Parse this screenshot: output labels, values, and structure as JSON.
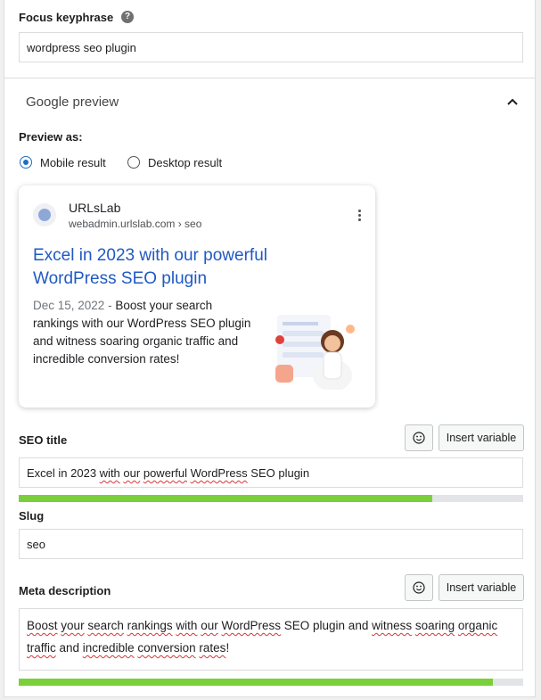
{
  "focus_keyphrase": {
    "label": "Focus keyphrase",
    "value": "wordpress seo plugin"
  },
  "google_preview": {
    "title": "Google preview",
    "preview_as_label": "Preview as:",
    "options": [
      "Mobile result",
      "Desktop result"
    ],
    "selected": "Mobile result",
    "card": {
      "site_name": "URLsLab",
      "site_url": "webadmin.urlslab.com › seo",
      "title": "Excel in 2023 with our powerful WordPress SEO plugin",
      "date": "Dec 15, 2022",
      "separator": " - ",
      "description": "Boost your search rankings with our WordPress SEO plugin and witness soaring organic traffic and incredible conversion rates!"
    }
  },
  "seo_title": {
    "label": "SEO title",
    "insert_variable": "Insert variable",
    "segments": [
      {
        "t": "Excel in 2023 ",
        "sq": false
      },
      {
        "t": "with",
        "sq": true
      },
      {
        "t": " ",
        "sq": false
      },
      {
        "t": "our",
        "sq": true
      },
      {
        "t": " ",
        "sq": false
      },
      {
        "t": "powerful",
        "sq": true
      },
      {
        "t": " ",
        "sq": false
      },
      {
        "t": "WordPress",
        "sq": true
      },
      {
        "t": " SEO plugin",
        "sq": false
      }
    ],
    "progress": 0.82,
    "progress_color": "#7ad03a"
  },
  "slug": {
    "label": "Slug",
    "value": "seo"
  },
  "meta_description": {
    "label": "Meta description",
    "insert_variable": "Insert variable",
    "segments": [
      {
        "t": "Boost",
        "sq": true
      },
      {
        "t": " ",
        "sq": false
      },
      {
        "t": "your",
        "sq": true
      },
      {
        "t": " ",
        "sq": false
      },
      {
        "t": "search",
        "sq": true
      },
      {
        "t": " ",
        "sq": false
      },
      {
        "t": "rankings",
        "sq": true
      },
      {
        "t": " ",
        "sq": false
      },
      {
        "t": "with",
        "sq": true
      },
      {
        "t": " ",
        "sq": false
      },
      {
        "t": "our",
        "sq": true
      },
      {
        "t": " ",
        "sq": false
      },
      {
        "t": "WordPress",
        "sq": true
      },
      {
        "t": " SEO plugin and ",
        "sq": false
      },
      {
        "t": "witness",
        "sq": true
      },
      {
        "t": " ",
        "sq": false
      },
      {
        "t": "soaring",
        "sq": true
      },
      {
        "t": " ",
        "sq": false
      },
      {
        "t": "organic",
        "sq": true
      },
      {
        "t": " ",
        "sq": false
      },
      {
        "t": "traffic",
        "sq": true
      },
      {
        "t": " and ",
        "sq": false
      },
      {
        "t": "incredible",
        "sq": true
      },
      {
        "t": " ",
        "sq": false
      },
      {
        "t": "conversion",
        "sq": true
      },
      {
        "t": " ",
        "sq": false
      },
      {
        "t": "rates",
        "sq": true
      },
      {
        "t": "!",
        "sq": false
      }
    ],
    "progress": 0.94,
    "progress_color": "#7ad03a"
  },
  "icons": [
    "help-icon",
    "chevron-up-icon",
    "kebab-menu-icon",
    "emoji-icon"
  ]
}
